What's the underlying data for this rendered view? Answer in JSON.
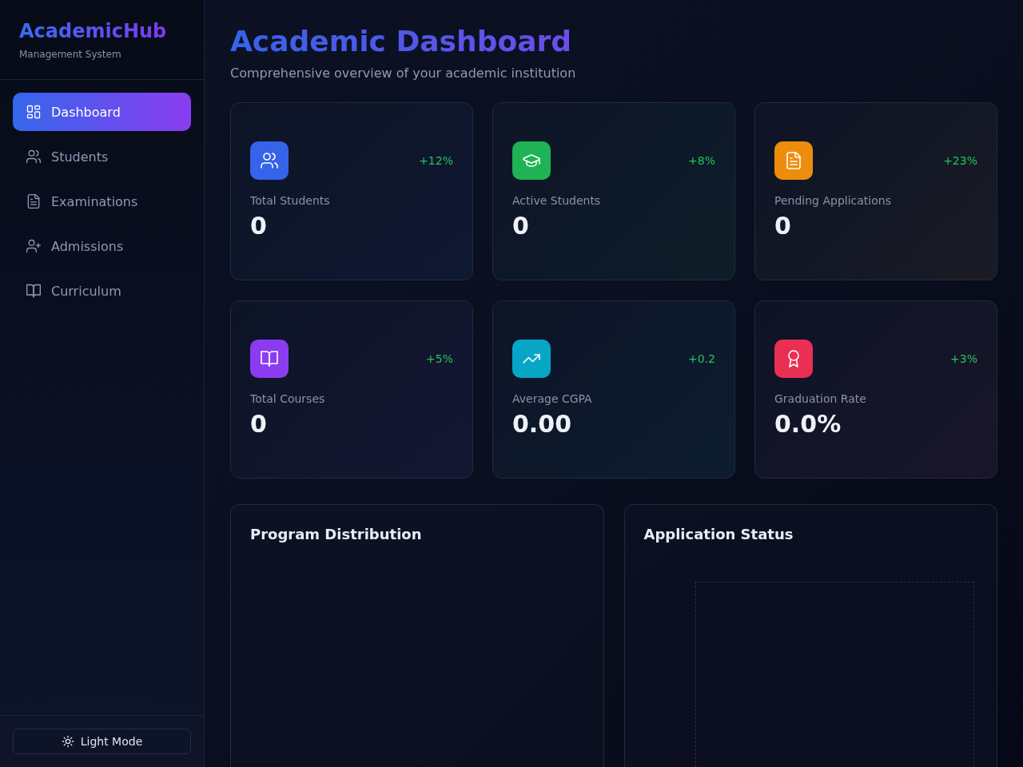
{
  "sidebar": {
    "logo": "AcademicHub",
    "subtitle": "Management System",
    "items": [
      {
        "label": "Dashboard",
        "selected": true
      },
      {
        "label": "Students",
        "selected": false
      },
      {
        "label": "Examinations",
        "selected": false
      },
      {
        "label": "Admissions",
        "selected": false
      },
      {
        "label": "Curriculum",
        "selected": false
      }
    ],
    "theme_toggle": {
      "label": "Light Mode"
    }
  },
  "header": {
    "title": "Academic Dashboard",
    "subtitle": "Comprehensive overview of your academic institution"
  },
  "stats": [
    {
      "label": "Total Students",
      "value": "0",
      "change": "+12%",
      "color": "#3563e9"
    },
    {
      "label": "Active Students",
      "value": "0",
      "change": "+8%",
      "color": "#1fb356"
    },
    {
      "label": "Pending Applications",
      "value": "0",
      "change": "+23%",
      "color": "#ee8d0b"
    },
    {
      "label": "Total Courses",
      "value": "0",
      "change": "+5%",
      "color": "#8b3cf0"
    },
    {
      "label": "Average CGPA",
      "value": "0.00",
      "change": "+0.2",
      "color": "#08a6c6"
    },
    {
      "label": "Graduation Rate",
      "value": "0.0%",
      "change": "+3%",
      "color": "#ea2f55"
    }
  ],
  "panels": [
    {
      "title": "Program Distribution",
      "kind": "blank"
    },
    {
      "title": "Application Status",
      "kind": "framed"
    }
  ]
}
